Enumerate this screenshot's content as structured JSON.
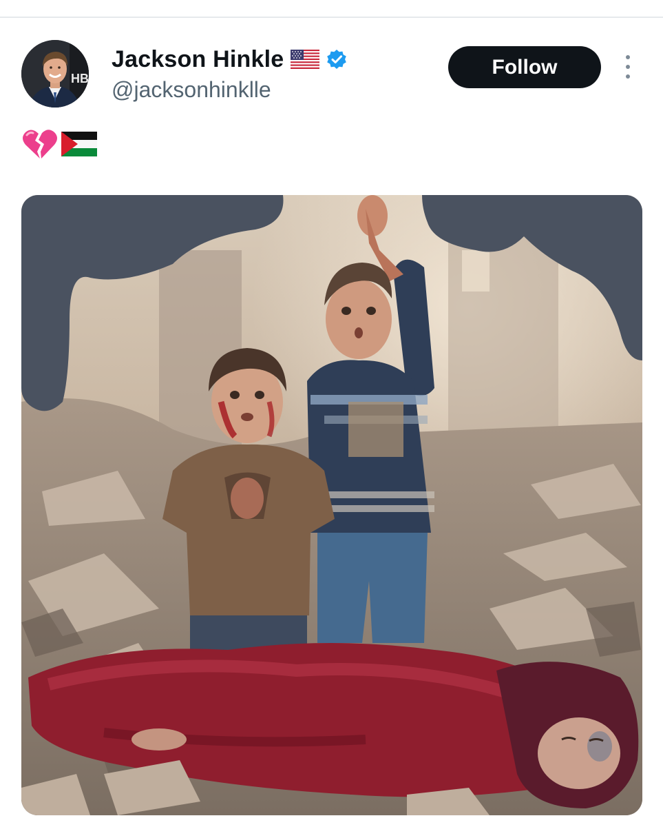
{
  "author": {
    "display_name": "Jackson Hinkle",
    "handle": "@jacksonhinklle",
    "flag_icon": "us-flag-icon",
    "verified_icon": "verified-badge-icon",
    "avatar_badge_text": "HB"
  },
  "actions": {
    "follow_label": "Follow",
    "more_icon": "more-vertical-icon"
  },
  "tweet": {
    "emojis": [
      "broken-heart-icon",
      "palestine-flag-icon"
    ]
  },
  "media": {
    "type": "photo",
    "alt_text": ""
  },
  "colors": {
    "text_primary": "#0f1419",
    "text_secondary": "#536471",
    "follow_bg": "#0f1419",
    "verified": "#1d9bf0",
    "redaction": "#4a5260"
  }
}
